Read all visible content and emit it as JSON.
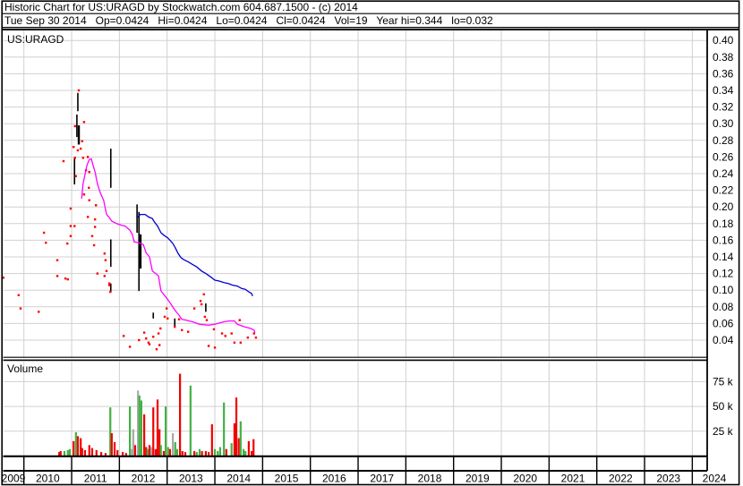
{
  "header": {
    "line1": "Historic Chart for US:URAGD by Stockwatch.com 604.687.1500 - (c) 2014",
    "line2": "Tue Sep 30 2014   Op=0.0424   Hi=0.0424   Lo=0.0424   Cl=0.0424   Vol=19   Year hi=0.344   lo=0.032"
  },
  "labels": {
    "symbol": "US:URAGD",
    "volume": "Volume"
  },
  "colors": {
    "background": "#ffffff",
    "text": "#000000",
    "grid": "#d0d0d0",
    "border": "#000000",
    "trade_dot": "#ff0000",
    "ma_fast": "#ff00ff",
    "ma_slow": "#0000cc",
    "vol_up": "#44b044",
    "vol_down": "#f20000",
    "vol_neutral": "#a8a8a8"
  },
  "chart_data": {
    "type": "scatter+line+bar stock historic chart",
    "title": "Historic Chart for US:URAGD",
    "grid": true,
    "x_axis": {
      "years": [
        "2009",
        "2010",
        "2011",
        "2012",
        "2013",
        "2014",
        "2015",
        "2016",
        "2017",
        "2018",
        "2019",
        "2020",
        "2021",
        "2022",
        "2023",
        "2024"
      ],
      "range": [
        2009.56,
        2024.31
      ]
    },
    "price_axis": {
      "side": "right",
      "tick_labels": [
        "0.40",
        "0.38",
        "0.36",
        "0.34",
        "0.32",
        "0.30",
        "0.28",
        "0.26",
        "0.24",
        "0.22",
        "0.20",
        "0.18",
        "0.16",
        "0.14",
        "0.12",
        "0.10",
        "0.08",
        "0.06",
        "0.04"
      ],
      "range": [
        0.018,
        0.412
      ]
    },
    "volume_axis": {
      "side": "right",
      "tick_labels": [
        "75 k",
        "50 k",
        "25 k"
      ],
      "tick_values": [
        75,
        50,
        25
      ],
      "unit": "thousand shares",
      "range": [
        0,
        95
      ]
    },
    "series": {
      "trades": {
        "name": "trade prices",
        "color": "#ff0000",
        "points": [
          [
            2011.15,
            0.34
          ],
          [
            2011.26,
            0.302
          ],
          [
            2011.07,
            0.297
          ],
          [
            2011.22,
            0.279
          ],
          [
            2011.04,
            0.272
          ],
          [
            2011.19,
            0.27
          ],
          [
            2011.13,
            0.268
          ],
          [
            2011.34,
            0.26
          ],
          [
            2011.24,
            0.259
          ],
          [
            2011.07,
            0.259
          ],
          [
            2010.83,
            0.255
          ],
          [
            2011.3,
            0.244
          ],
          [
            2011.37,
            0.242
          ],
          [
            2011.09,
            0.237
          ],
          [
            2011.36,
            0.223
          ],
          [
            2011.26,
            0.215
          ],
          [
            2011.37,
            0.208
          ],
          [
            2011.51,
            0.202
          ],
          [
            2010.98,
            0.198
          ],
          [
            2011.34,
            0.188
          ],
          [
            2011.49,
            0.185
          ],
          [
            2010.98,
            0.177
          ],
          [
            2011.06,
            0.177
          ],
          [
            2011.49,
            0.176
          ],
          [
            2010.42,
            0.169
          ],
          [
            2010.98,
            0.165
          ],
          [
            2011.43,
            0.165
          ],
          [
            2010.46,
            0.157
          ],
          [
            2010.91,
            0.156
          ],
          [
            2011.47,
            0.154
          ],
          [
            2011.69,
            0.144
          ],
          [
            2011.71,
            0.136
          ],
          [
            2010.7,
            0.136
          ],
          [
            2011.73,
            0.123
          ],
          [
            2011.54,
            0.12
          ],
          [
            2011.69,
            0.117
          ],
          [
            2009.57,
            0.115
          ],
          [
            2010.7,
            0.117
          ],
          [
            2010.87,
            0.114
          ],
          [
            2010.92,
            0.113
          ],
          [
            2011.79,
            0.108
          ],
          [
            2011.79,
            0.106
          ],
          [
            2011.81,
            0.098
          ],
          [
            2009.89,
            0.094
          ],
          [
            2009.93,
            0.078
          ],
          [
            2010.31,
            0.074
          ],
          [
            2013.77,
            0.095
          ],
          [
            2013.7,
            0.087
          ],
          [
            2013.72,
            0.083
          ],
          [
            2013.57,
            0.078
          ],
          [
            2013.79,
            0.068
          ],
          [
            2013.83,
            0.064
          ],
          [
            2012.99,
            0.078
          ],
          [
            2012.95,
            0.068
          ],
          [
            2013.01,
            0.066
          ],
          [
            2012.82,
            0.048
          ],
          [
            2012.86,
            0.054
          ],
          [
            2012.71,
            0.044
          ],
          [
            2012.78,
            0.029
          ],
          [
            2012.84,
            0.034
          ],
          [
            2012.61,
            0.037
          ],
          [
            2012.22,
            0.032
          ],
          [
            2012.09,
            0.045
          ],
          [
            2012.41,
            0.04
          ],
          [
            2012.52,
            0.049
          ],
          [
            2012.56,
            0.042
          ],
          [
            2012.63,
            0.035
          ],
          [
            2013.31,
            0.052
          ],
          [
            2013.44,
            0.05
          ],
          [
            2013.16,
            0.056
          ],
          [
            2013.25,
            0.065
          ],
          [
            2013.98,
            0.053
          ],
          [
            2014.15,
            0.048
          ],
          [
            2014.22,
            0.045
          ],
          [
            2014.41,
            0.037
          ],
          [
            2014.54,
            0.037
          ],
          [
            2014.35,
            0.048
          ],
          [
            2014.52,
            0.064
          ],
          [
            2014.69,
            0.043
          ],
          [
            2014.0,
            0.031
          ],
          [
            2013.87,
            0.033
          ],
          [
            2014.82,
            0.048
          ],
          [
            2014.86,
            0.043
          ]
        ]
      },
      "hl_bars": {
        "name": "high-low bars",
        "color": "#000000",
        "bars": [
          [
            2011.13,
            0.337,
            0.315,
            1.6
          ],
          [
            2011.11,
            0.311,
            0.284,
            1.6
          ],
          [
            2011.15,
            0.298,
            0.275,
            2.4
          ],
          [
            2011.06,
            0.26,
            0.227,
            1.6
          ],
          [
            2011.82,
            0.27,
            0.223,
            1.6
          ],
          [
            2011.82,
            0.161,
            0.128,
            1.6
          ],
          [
            2011.82,
            0.108,
            0.097,
            1.6
          ],
          [
            2012.37,
            0.203,
            0.169,
            1.6
          ],
          [
            2012.41,
            0.194,
            0.099,
            1.6
          ],
          [
            2012.44,
            0.167,
            0.126,
            2.6
          ],
          [
            2012.71,
            0.073,
            0.066,
            1.6
          ],
          [
            2013.16,
            0.066,
            0.055,
            1.6
          ],
          [
            2013.81,
            0.084,
            0.074,
            1.6
          ]
        ]
      },
      "ma_fast": {
        "name": "short moving average",
        "color": "#ff00ff",
        "points": [
          [
            2011.21,
            0.21
          ],
          [
            2011.24,
            0.228
          ],
          [
            2011.28,
            0.239
          ],
          [
            2011.32,
            0.25
          ],
          [
            2011.37,
            0.257
          ],
          [
            2011.41,
            0.258
          ],
          [
            2011.45,
            0.25
          ],
          [
            2011.49,
            0.242
          ],
          [
            2011.54,
            0.228
          ],
          [
            2011.6,
            0.217
          ],
          [
            2011.67,
            0.208
          ],
          [
            2011.73,
            0.191
          ],
          [
            2011.79,
            0.187
          ],
          [
            2011.84,
            0.183
          ],
          [
            2011.94,
            0.18
          ],
          [
            2012.05,
            0.178
          ],
          [
            2012.12,
            0.177
          ],
          [
            2012.22,
            0.172
          ],
          [
            2012.27,
            0.167
          ],
          [
            2012.31,
            0.158
          ],
          [
            2012.41,
            0.157
          ],
          [
            2012.5,
            0.155
          ],
          [
            2012.56,
            0.145
          ],
          [
            2012.63,
            0.14
          ],
          [
            2012.69,
            0.123
          ],
          [
            2012.76,
            0.12
          ],
          [
            2012.82,
            0.117
          ],
          [
            2012.87,
            0.099
          ],
          [
            2012.97,
            0.092
          ],
          [
            2013.06,
            0.085
          ],
          [
            2013.14,
            0.078
          ],
          [
            2013.19,
            0.074
          ],
          [
            2013.25,
            0.07
          ],
          [
            2013.31,
            0.065
          ],
          [
            2013.4,
            0.064
          ],
          [
            2013.53,
            0.062
          ],
          [
            2013.68,
            0.059
          ],
          [
            2013.87,
            0.058
          ],
          [
            2014.0,
            0.059
          ],
          [
            2014.19,
            0.062
          ],
          [
            2014.3,
            0.063
          ],
          [
            2014.41,
            0.063
          ],
          [
            2014.47,
            0.059
          ],
          [
            2014.62,
            0.056
          ],
          [
            2014.75,
            0.054
          ],
          [
            2014.82,
            0.052
          ],
          [
            2014.84,
            0.049
          ]
        ]
      },
      "ma_slow": {
        "name": "long moving average",
        "color": "#0000cc",
        "points": [
          [
            2012.37,
            0.187
          ],
          [
            2012.44,
            0.191
          ],
          [
            2012.54,
            0.191
          ],
          [
            2012.61,
            0.188
          ],
          [
            2012.69,
            0.186
          ],
          [
            2012.72,
            0.183
          ],
          [
            2012.8,
            0.177
          ],
          [
            2012.87,
            0.169
          ],
          [
            2012.93,
            0.166
          ],
          [
            2013.01,
            0.163
          ],
          [
            2013.06,
            0.16
          ],
          [
            2013.12,
            0.156
          ],
          [
            2013.17,
            0.151
          ],
          [
            2013.23,
            0.144
          ],
          [
            2013.29,
            0.139
          ],
          [
            2013.34,
            0.137
          ],
          [
            2013.44,
            0.134
          ],
          [
            2013.53,
            0.131
          ],
          [
            2013.62,
            0.128
          ],
          [
            2013.72,
            0.123
          ],
          [
            2013.81,
            0.12
          ],
          [
            2013.91,
            0.116
          ],
          [
            2014.0,
            0.112
          ],
          [
            2014.09,
            0.111
          ],
          [
            2014.19,
            0.109
          ],
          [
            2014.28,
            0.108
          ],
          [
            2014.37,
            0.106
          ],
          [
            2014.47,
            0.105
          ],
          [
            2014.56,
            0.102
          ],
          [
            2014.64,
            0.101
          ],
          [
            2014.71,
            0.098
          ],
          [
            2014.77,
            0.096
          ],
          [
            2014.79,
            0.093
          ]
        ]
      },
      "volume": {
        "name": "volume (thousand shares)",
        "color_map": {
          "u": "#44b044",
          "d": "#f20000",
          "n": "#a8a8a8"
        },
        "bars": [
          [
            2010.74,
            4,
            "d"
          ],
          [
            2010.77,
            5,
            "d"
          ],
          [
            2010.85,
            5,
            "u"
          ],
          [
            2010.92,
            6,
            "u"
          ],
          [
            2010.96,
            7,
            "u"
          ],
          [
            2011.04,
            15,
            "d"
          ],
          [
            2011.09,
            24,
            "u"
          ],
          [
            2011.13,
            20,
            "d"
          ],
          [
            2011.19,
            18,
            "d"
          ],
          [
            2011.22,
            8,
            "d"
          ],
          [
            2011.28,
            6,
            "d"
          ],
          [
            2011.37,
            11,
            "d"
          ],
          [
            2011.43,
            8,
            "d"
          ],
          [
            2011.52,
            6,
            "d"
          ],
          [
            2011.62,
            4,
            "d"
          ],
          [
            2011.71,
            3,
            "d"
          ],
          [
            2011.81,
            49,
            "u"
          ],
          [
            2011.84,
            23,
            "d"
          ],
          [
            2011.9,
            14,
            "d"
          ],
          [
            2011.96,
            6,
            "d"
          ],
          [
            2012.07,
            4,
            "d"
          ],
          [
            2012.14,
            3,
            "d"
          ],
          [
            2012.22,
            50,
            "u"
          ],
          [
            2012.26,
            7,
            "n"
          ],
          [
            2012.29,
            27,
            "n"
          ],
          [
            2012.33,
            11,
            "d"
          ],
          [
            2012.39,
            66,
            "n"
          ],
          [
            2012.42,
            61,
            "u"
          ],
          [
            2012.46,
            56,
            "u"
          ],
          [
            2012.52,
            42,
            "d"
          ],
          [
            2012.56,
            9,
            "d"
          ],
          [
            2012.59,
            7,
            "u"
          ],
          [
            2012.63,
            11,
            "d"
          ],
          [
            2012.67,
            9,
            "n"
          ],
          [
            2012.71,
            49,
            "d"
          ],
          [
            2012.76,
            7,
            "d"
          ],
          [
            2012.8,
            57,
            "d"
          ],
          [
            2012.84,
            27,
            "d"
          ],
          [
            2012.87,
            11,
            "u"
          ],
          [
            2012.93,
            5,
            "d"
          ],
          [
            2012.97,
            50,
            "u"
          ],
          [
            2013.02,
            9,
            "u"
          ],
          [
            2013.06,
            7,
            "d"
          ],
          [
            2013.12,
            23,
            "n"
          ],
          [
            2013.17,
            14,
            "u"
          ],
          [
            2013.21,
            7,
            "u"
          ],
          [
            2013.27,
            83,
            "d"
          ],
          [
            2013.32,
            5,
            "d"
          ],
          [
            2013.38,
            4,
            "d"
          ],
          [
            2013.49,
            71,
            "u"
          ],
          [
            2013.57,
            5,
            "d"
          ],
          [
            2013.62,
            4,
            "u"
          ],
          [
            2013.68,
            7,
            "u"
          ],
          [
            2013.73,
            5,
            "d"
          ],
          [
            2013.81,
            5,
            "d"
          ],
          [
            2013.87,
            4,
            "d"
          ],
          [
            2013.94,
            32,
            "d"
          ],
          [
            2014.0,
            7,
            "u"
          ],
          [
            2014.06,
            5,
            "u"
          ],
          [
            2014.11,
            9,
            "u"
          ],
          [
            2014.19,
            54,
            "u"
          ],
          [
            2014.24,
            7,
            "d"
          ],
          [
            2014.35,
            13,
            "u"
          ],
          [
            2014.41,
            33,
            "d"
          ],
          [
            2014.45,
            59,
            "d"
          ],
          [
            2014.5,
            18,
            "d"
          ],
          [
            2014.54,
            35,
            "u"
          ],
          [
            2014.6,
            7,
            "u"
          ],
          [
            2014.64,
            5,
            "u"
          ],
          [
            2014.71,
            15,
            "d"
          ],
          [
            2014.77,
            5,
            "d"
          ],
          [
            2014.81,
            17,
            "d"
          ]
        ]
      }
    }
  }
}
